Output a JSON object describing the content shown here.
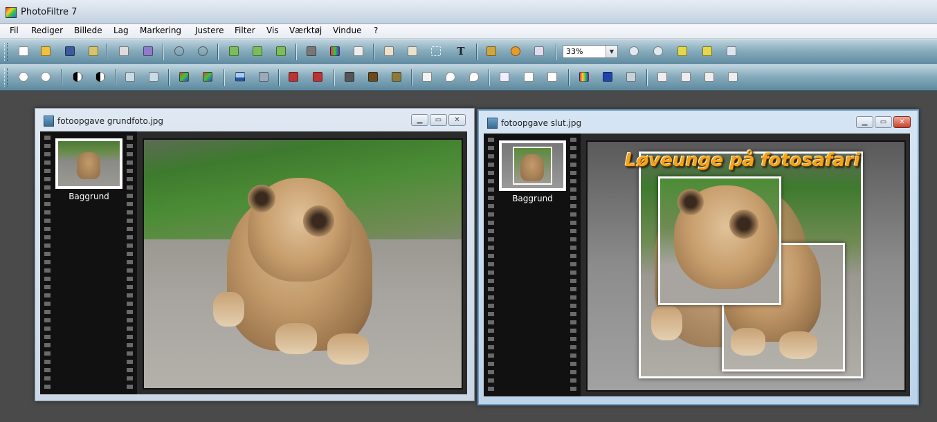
{
  "app": {
    "title": "PhotoFiltre 7"
  },
  "menu": [
    "Fil",
    "Rediger",
    "Billede",
    "Lag",
    "Markering",
    "Justere",
    "Filter",
    "Vis",
    "Værktøj",
    "Vindue",
    "?"
  ],
  "toolbar": {
    "zoom_value": "33%",
    "text_tool_glyph": "T"
  },
  "windows": [
    {
      "title": "fotoopgave grundfoto.jpg",
      "layer_label": "Baggrund",
      "active": false
    },
    {
      "title": "fotoopgave slut.jpg",
      "layer_label": "Baggrund",
      "active": true,
      "overlay_text": "Løveunge på fotosafari"
    }
  ],
  "colors": {
    "workspace": "#4a4a4a",
    "title_text": "#f4a21a",
    "close_active": "#c8432e"
  }
}
